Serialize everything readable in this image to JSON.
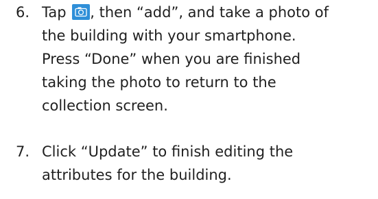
{
  "steps": [
    {
      "number": "6.",
      "lines": [
        {
          "before_icon": "Tap ",
          "icon": "camera-icon",
          "after_icon": ", then “add”, and take a photo of"
        },
        {
          "text": "the building with your smartphone."
        },
        {
          "text": "Press “Done” when you are finished"
        },
        {
          "text": "taking the photo to return to the"
        },
        {
          "text": "collection screen."
        }
      ]
    },
    {
      "number": "7.",
      "lines": [
        {
          "text": "Click “Update” to finish editing the"
        },
        {
          "text": "attributes for the building."
        }
      ]
    }
  ],
  "colors": {
    "text": "#1f1f1f",
    "icon_background": "#2f8fd8",
    "icon_glyph": "#ffffff"
  }
}
